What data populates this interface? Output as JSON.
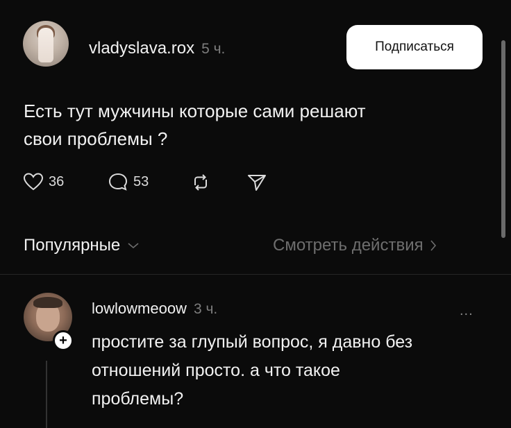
{
  "post": {
    "username": "vladyslava.rox",
    "time": "5 ч.",
    "subscribe_label": "Подписаться",
    "text_line1": "Есть тут мужчины которые сами решают",
    "text_line2": "свои проблемы ?",
    "likes": "36",
    "comments": "53",
    "icons": [
      "heart-icon",
      "comment-icon",
      "repost-icon",
      "send-icon"
    ]
  },
  "sort": {
    "label": "Популярные",
    "view_actions": "Смотреть действия"
  },
  "comment": {
    "username": "lowlowmeoow",
    "time": "3 ч.",
    "more": "...",
    "text_line1": "простите за глупый вопрос, я давно без",
    "text_line2": "отношений просто. а что такое",
    "text_line3": "проблемы?"
  },
  "colors": {
    "background": "#0b0b0b",
    "text": "#f2f2f2",
    "muted": "#7d7d7d",
    "button": "#ffffff"
  }
}
